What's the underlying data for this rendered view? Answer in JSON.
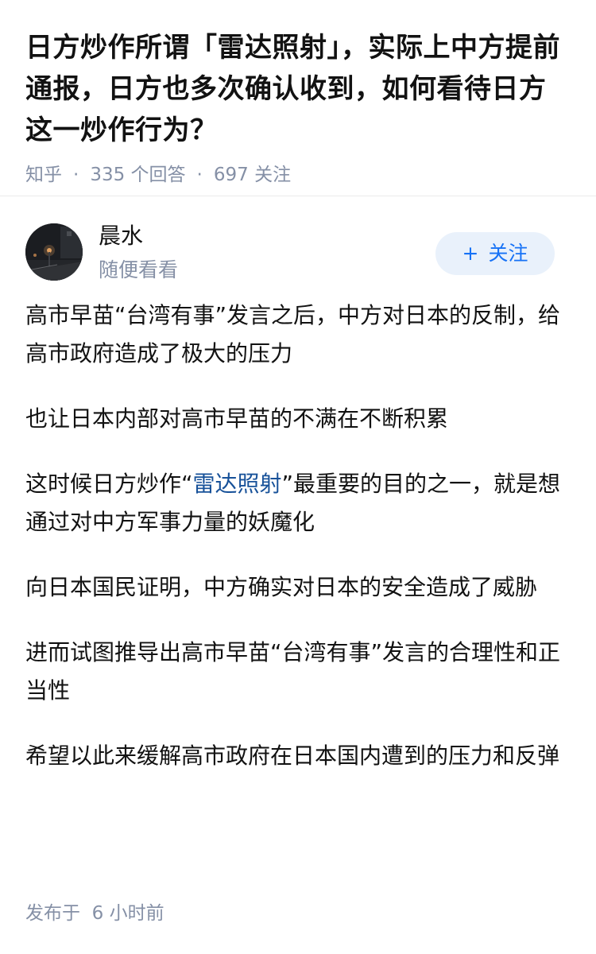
{
  "question": {
    "title": "日方炒作所谓「雷达照射」，实际上中方提前通报，日方也多次确认收到，如何看待日方这一炒作行为？",
    "meta": {
      "source": "知乎",
      "answer_count": "335",
      "answer_label": "个回答",
      "follow_count": "697",
      "follow_label": "关注"
    }
  },
  "author": {
    "name": "晨水",
    "bio": "随便看看",
    "avatar_icon": "night-street-photo",
    "follow_button": {
      "icon": "plus-icon",
      "label": "关注"
    }
  },
  "answer": {
    "paragraphs": [
      {
        "parts": [
          {
            "text": "高市早苗“台湾有事”发言之后，中方对日本的反制，给高市政府造成了极大的压力"
          }
        ]
      },
      {
        "parts": [
          {
            "text": "也让日本内部对高市早苗的不满在不断积累"
          }
        ]
      },
      {
        "parts": [
          {
            "text": "这时候日方炒作“"
          },
          {
            "text": "雷达照射",
            "link": true
          },
          {
            "text": "”最重要的目的之一，就是想通过对中方军事力量的妖魔化"
          }
        ]
      },
      {
        "parts": [
          {
            "text": "向日本国民证明，中方确实对日本的安全造成了威胁"
          }
        ]
      },
      {
        "parts": [
          {
            "text": "进而试图推导出高市早苗“台湾有事”发言的合理性和正当性"
          }
        ]
      },
      {
        "parts": [
          {
            "text": "希望以此来缓解高市政府在日本国内遭到的压力和反弹"
          }
        ]
      }
    ],
    "publish_label": "发布于",
    "publish_time": "6 小时前"
  },
  "colors": {
    "text": "#121212",
    "muted": "#8590a6",
    "link": "#175199",
    "accent": "#1772f6",
    "follow_bg": "#e9f1fb"
  }
}
